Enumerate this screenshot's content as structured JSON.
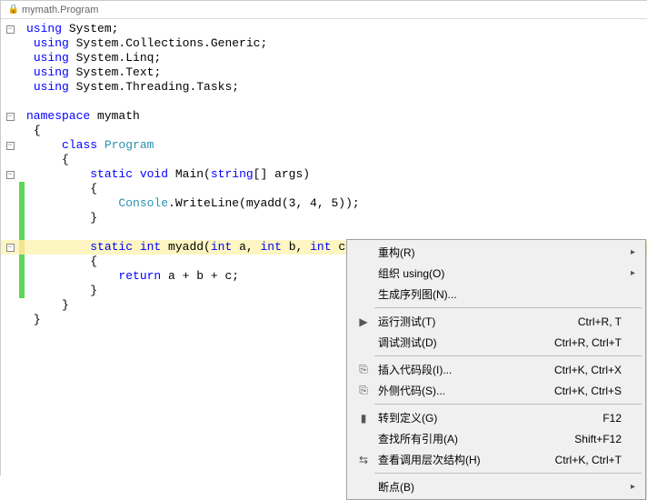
{
  "tab": {
    "title": "mymath.Program"
  },
  "code": {
    "l1_kw": "using",
    "l1_rest": " System;",
    "l2_kw": "using",
    "l2_rest": " System.Collections.Generic;",
    "l3_kw": "using",
    "l3_rest": " System.Linq;",
    "l4_kw": "using",
    "l4_rest": " System.Text;",
    "l5_kw": "using",
    "l5_rest": " System.Threading.Tasks;",
    "l7_kw": "namespace",
    "l7_rest": " mymath",
    "brace_open": "{",
    "brace_close": "}",
    "l9_kw": "class",
    "l9_type": " Program",
    "l11_static": "static",
    "l11_void": " void",
    "l11_main": " Main(",
    "l11_string": "string",
    "l11_args": "[] args)",
    "l13_console": "Console",
    "l13_rest": ".WriteLine(myadd(3, 4, 5));",
    "l16_static": "static",
    "l16_int": " int",
    "l16_myadd": " myadd(",
    "l16_int_a": "int",
    "l16_a": " a, ",
    "l16_int_b": "int",
    "l16_b": " b, ",
    "l16_int_c": "int",
    "l16_c": " c)",
    "l18_kw": "return",
    "l18_rest": " a + b + c;"
  },
  "menu": {
    "refactor": "重构(R)",
    "organize_using": "组织 using(O)",
    "gen_seq_diagram": "生成序列图(N)...",
    "run_tests": "运行测试(T)",
    "run_tests_key": "Ctrl+R, T",
    "debug_tests": "调试测试(D)",
    "debug_tests_key": "Ctrl+R, Ctrl+T",
    "insert_snippet": "插入代码段(I)...",
    "insert_snippet_key": "Ctrl+K, Ctrl+X",
    "surround_with": "外侧代码(S)...",
    "surround_with_key": "Ctrl+K, Ctrl+S",
    "goto_def": "转到定义(G)",
    "goto_def_key": "F12",
    "find_refs": "查找所有引用(A)",
    "find_refs_key": "Shift+F12",
    "view_call_hier": "查看调用层次结构(H)",
    "view_call_hier_key": "Ctrl+K, Ctrl+T",
    "breakpoint": "断点(B)"
  }
}
